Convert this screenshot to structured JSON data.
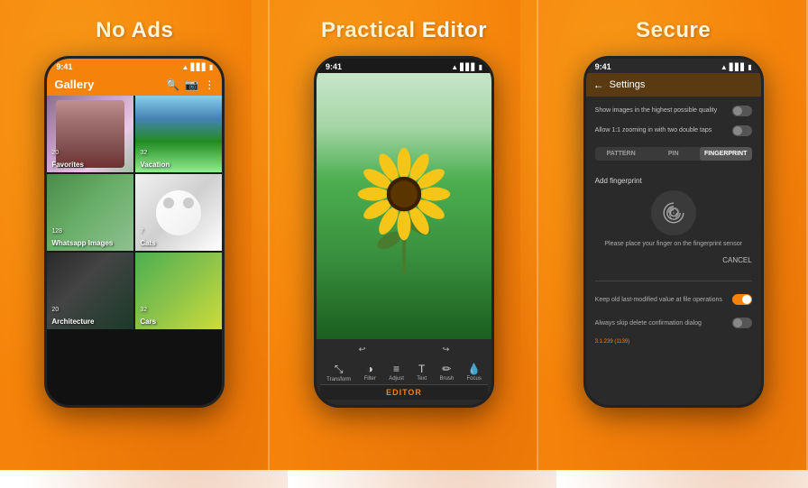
{
  "panels": [
    {
      "id": "no-ads",
      "title": "No Ads",
      "phone": {
        "time": "9:41",
        "app_title": "Gallery",
        "albums": [
          {
            "name": "Favorites",
            "count": "20",
            "tile": "1"
          },
          {
            "name": "Vacation",
            "count": "32",
            "tile": "2"
          },
          {
            "name": "Whatsapp Images",
            "count": "128",
            "tile": "3"
          },
          {
            "name": "Cats",
            "count": "7",
            "tile": "4"
          },
          {
            "name": "Architecture",
            "count": "20",
            "tile": "5"
          },
          {
            "name": "Cars",
            "count": "32",
            "tile": "6"
          }
        ]
      }
    },
    {
      "id": "editor",
      "title": "Practical Editor",
      "phone": {
        "time": "9:41",
        "tab_label": "EDITOR",
        "bottom_icons": [
          "Transform",
          "Filter",
          "Adjust",
          "Text",
          "Brush",
          "Focus"
        ]
      }
    },
    {
      "id": "secure",
      "title": "Secure",
      "phone": {
        "time": "9:41",
        "settings_title": "Settings",
        "setting1": "Show images in the highest possible quality",
        "setting2": "Allow 1:1 zooming in with two double taps",
        "auth_tabs": [
          "PATTERN",
          "PIN",
          "FINGERPRINT"
        ],
        "add_fingerprint": "Add fingerprint",
        "fingerprint_hint": "Please place your finger on the fingerprint sensor",
        "cancel_label": "CANCEL",
        "setting3": "Keep old last-modified value at file operations",
        "setting4": "Always skip delete confirmation dialog",
        "version": "3.1.239 (1139)"
      }
    }
  ]
}
